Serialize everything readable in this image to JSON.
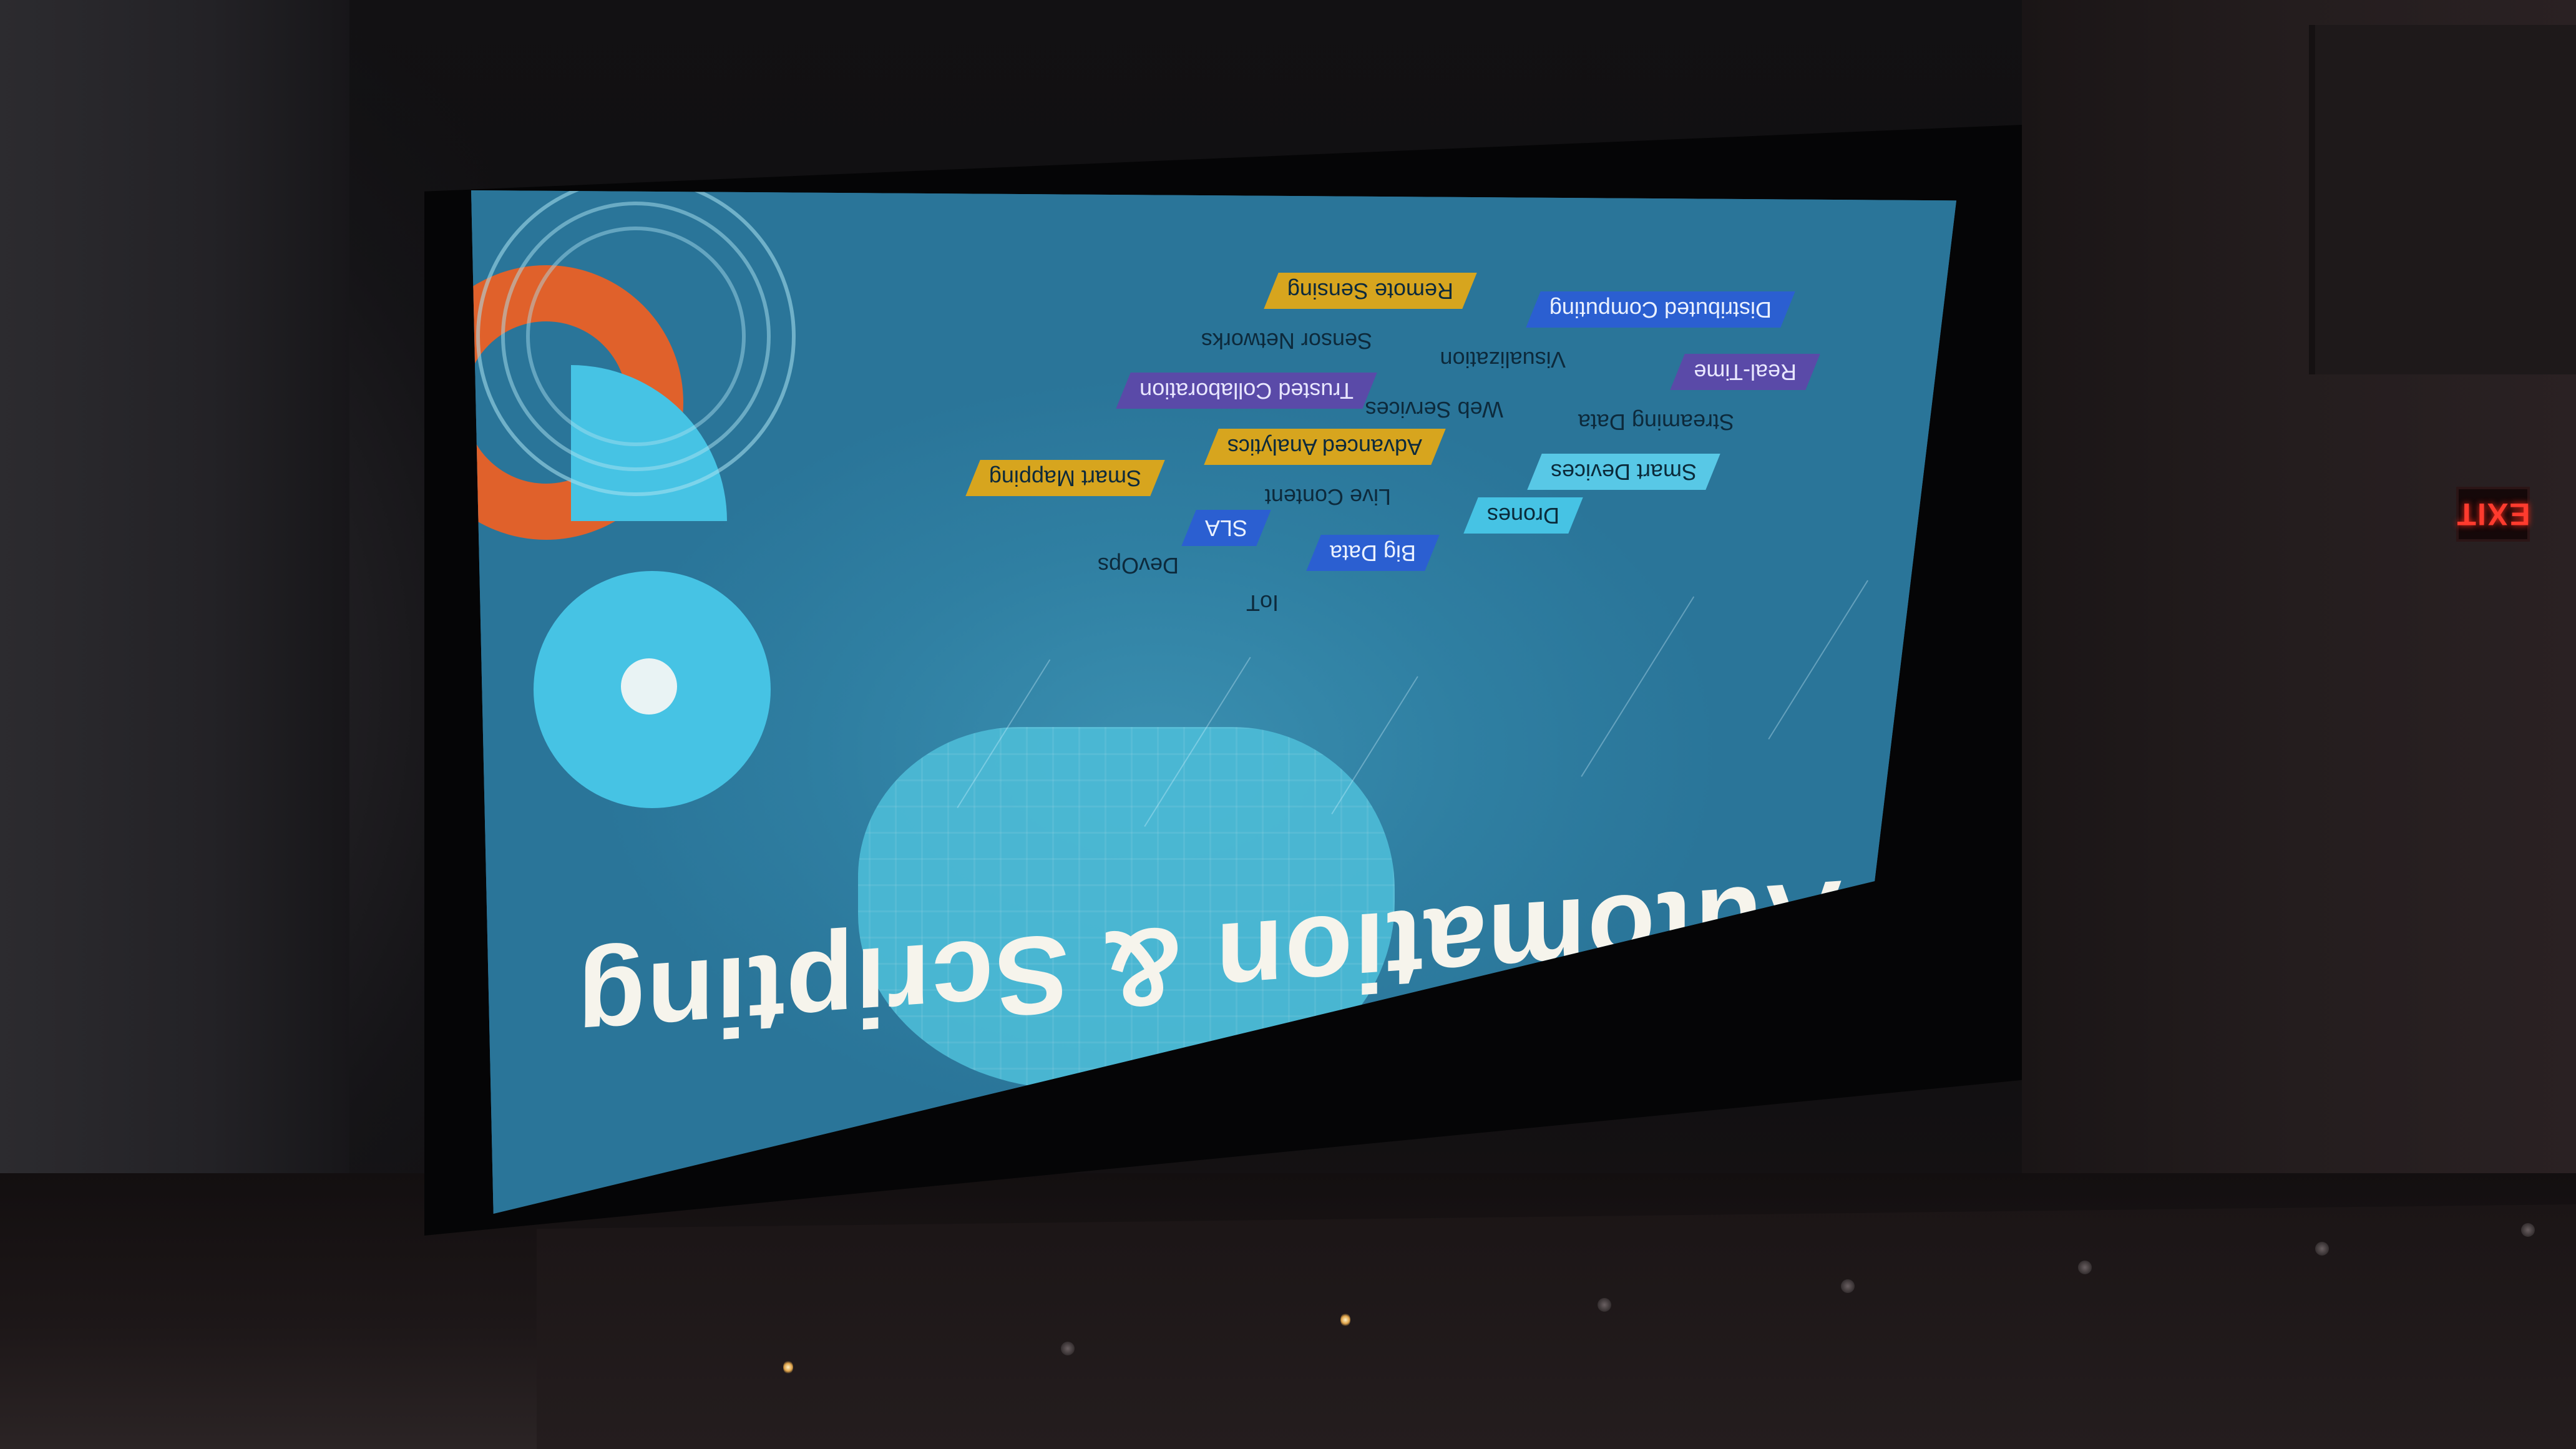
{
  "slide": {
    "title": "Automation & Scripting",
    "tags": [
      {
        "label": "Remote Sensing",
        "style": "yellow"
      },
      {
        "label": "Distributed Computing",
        "style": "blue"
      },
      {
        "label": "Sensor Networks",
        "style": "plain"
      },
      {
        "label": "Visualization",
        "style": "plain"
      },
      {
        "label": "Real-Time",
        "style": "purple"
      },
      {
        "label": "Trusted Collaboration",
        "style": "purple"
      },
      {
        "label": "Web Services",
        "style": "plain"
      },
      {
        "label": "Streaming Data",
        "style": "plain"
      },
      {
        "label": "Advanced Analytics",
        "style": "yellow"
      },
      {
        "label": "Smart Devices",
        "style": "lightblue"
      },
      {
        "label": "Smart Mapping",
        "style": "yellow"
      },
      {
        "label": "Live Content",
        "style": "plain"
      },
      {
        "label": "Drones",
        "style": "cyan"
      },
      {
        "label": "SLA",
        "style": "blue"
      },
      {
        "label": "Big Data",
        "style": "blue"
      },
      {
        "label": "DevOps",
        "style": "plain"
      },
      {
        "label": "IoT",
        "style": "plain"
      }
    ],
    "colors": {
      "background": "#2b789c",
      "cloud": "#4dbbd6",
      "accent_orange": "#e0612b",
      "accent_cyan": "#46c3e4",
      "accent_yellow": "#d7a51e",
      "accent_purple": "#5a4aa8",
      "accent_blue": "#2b5fd1"
    }
  },
  "exit_sign": {
    "label": "EXIT",
    "color": "#ff3b2e"
  }
}
